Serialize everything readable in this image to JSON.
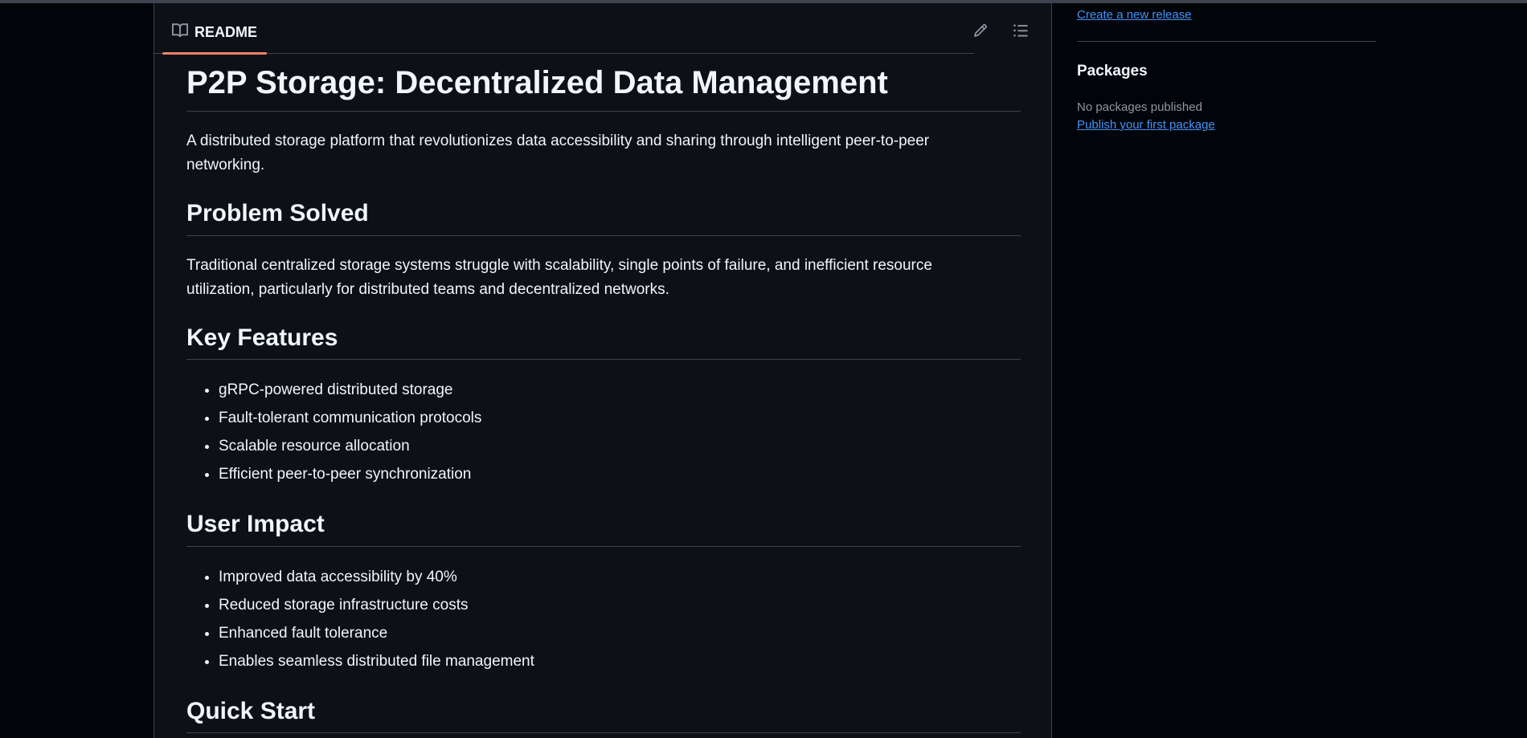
{
  "sidebar": {
    "release_link": "Create a new release",
    "packages_heading": "Packages",
    "no_packages": "No packages published",
    "publish_link": "Publish your first package"
  },
  "readme": {
    "tab_label": "README",
    "title": "P2P Storage: Decentralized Data Management",
    "intro": "A distributed storage platform that revolutionizes data accessibility and sharing through intelligent peer-to-peer networking.",
    "sections": {
      "problem": {
        "heading": "Problem Solved",
        "text": "Traditional centralized storage systems struggle with scalability, single points of failure, and inefficient resource utilization, particularly for distributed teams and decentralized networks."
      },
      "features": {
        "heading": "Key Features",
        "items": [
          "gRPC-powered distributed storage",
          "Fault-tolerant communication protocols",
          "Scalable resource allocation",
          "Efficient peer-to-peer synchronization"
        ]
      },
      "impact": {
        "heading": "User Impact",
        "items": [
          "Improved data accessibility by 40%",
          "Reduced storage infrastructure costs",
          "Enhanced fault tolerance",
          "Enables seamless distributed file management"
        ]
      },
      "quickstart": {
        "heading": "Quick Start"
      }
    }
  },
  "icons": {
    "readme_tab": "book-icon",
    "edit": "pencil-icon",
    "outline": "list-unordered-icon"
  },
  "colors": {
    "accent_underline": "#f78166",
    "link": "#4493f8",
    "background": "#0d1117"
  }
}
